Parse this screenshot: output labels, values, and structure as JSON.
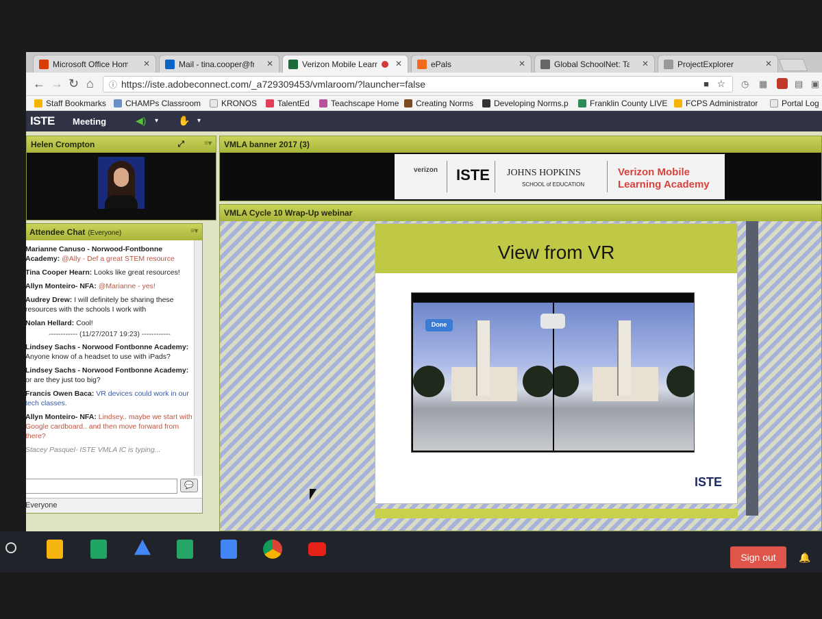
{
  "tabs": [
    {
      "label": "Microsoft Office Home",
      "icon": "office-icon",
      "color": "#d83b01"
    },
    {
      "label": "Mail - tina.cooper@franklin",
      "icon": "outlook-icon",
      "color": "#0a64c8"
    },
    {
      "label": "Verizon Mobile Learn",
      "icon": "connect-icon",
      "color": "#1c6b3a"
    },
    {
      "label": "ePals",
      "icon": "epals-icon",
      "color": "#f26b1d"
    },
    {
      "label": "Global SchoolNet: Take",
      "icon": "globe-icon",
      "color": "#666666"
    },
    {
      "label": "ProjectExplorer",
      "icon": "page-icon",
      "color": "#999999"
    }
  ],
  "toolbar": {
    "url": "https://iste.adobeconnect.com/_a729309453/vmlaroom/?launcher=false"
  },
  "bookmarks": [
    {
      "label": "Staff Bookmarks",
      "icon": "folder-icon"
    },
    {
      "label": "CHAMPs Classroom",
      "icon": "champs-icon"
    },
    {
      "label": "KRONOS",
      "icon": "page-icon"
    },
    {
      "label": "TalentEd",
      "icon": "talented-icon"
    },
    {
      "label": "Teachscape Home",
      "icon": "teachscape-icon"
    },
    {
      "label": "Creating Norms",
      "icon": "norms-icon"
    },
    {
      "label": "Developing Norms.p",
      "icon": "pdf-icon"
    },
    {
      "label": "Franklin County LIVE",
      "icon": "franklin-icon"
    },
    {
      "label": "FCPS Administrator",
      "icon": "drive-icon"
    },
    {
      "label": "Portal Log",
      "icon": "page-icon"
    }
  ],
  "app": {
    "logo": "ISTE",
    "meeting_label": "Meeting"
  },
  "camera_pod": {
    "title": "Helen Crompton"
  },
  "chat": {
    "title": "Attendee Chat",
    "scope": "(Everyone)",
    "messages": [
      {
        "who": "Marianne Canuso - Norwood-Fontbonne Academy:",
        "text": "@Ally - Def a great STEM resource",
        "highlight": true
      },
      {
        "who": "Tina Cooper Hearn:",
        "text": "Looks like great resources!",
        "highlight": false
      },
      {
        "who": "Allyn Monteiro- NFA:",
        "text": "@Marianne - yes!",
        "highlight": true
      },
      {
        "who": "Audrey Drew:",
        "text": "I will definitely be sharing these resources with the schools I work with",
        "highlight": false
      },
      {
        "who": "Nolan Hellard:",
        "text": "Cool!",
        "highlight": false
      },
      {
        "separator": "------------ (11/27/2017 19:23) ------------"
      },
      {
        "who": "Lindsey Sachs - Norwood Fontbonne Academy:",
        "text": "Anyone know of a headset to use with iPads?",
        "highlight": false
      },
      {
        "who": "Lindsey Sachs - Norwood Fontbonne Academy:",
        "text": "or are they just too big?",
        "highlight": false
      },
      {
        "who": "Francis Owen Baca:",
        "text": "VR devices could work in our tech classes.",
        "highlight": false
      },
      {
        "who": "Allyn Monteiro- NFA:",
        "text": "Lindsey.. maybe we start with Google cardboard.. and then move forward from there?",
        "highlight": true
      }
    ],
    "typing": "Stacey Pasquel- ISTE VMLA IC is typing...",
    "footer": "Everyone"
  },
  "banner_pod": {
    "title": "VMLA banner 2017 (3)",
    "brands": [
      "verizon",
      "ISTE",
      "JOHNS HOPKINS",
      "SCHOOL of EDUCATION",
      "Verizon Mobile",
      "Learning Academy"
    ]
  },
  "share_pod": {
    "title": "VMLA Cycle 10 Wrap-Up webinar",
    "slide_title": "View from VR",
    "done_label": "Done",
    "slide_logo": "ISTE"
  },
  "shelf": {
    "apps": [
      {
        "icon": "keep-icon",
        "color": "#f6b40e"
      },
      {
        "icon": "sheets-icon",
        "color": "#1fa463"
      },
      {
        "icon": "drive-icon",
        "color": "#4285f4"
      },
      {
        "icon": "classroom-icon",
        "color": "#25a667"
      },
      {
        "icon": "docs-icon",
        "color": "#4285f4"
      },
      {
        "icon": "chrome-icon",
        "color": "#db4437"
      },
      {
        "icon": "youtube-icon",
        "color": "#e62117"
      }
    ],
    "signout_label": "Sign out"
  },
  "colors": {
    "pod_header": "#b8c44a",
    "appbar": "#2f3345",
    "signout": "#e05549"
  }
}
